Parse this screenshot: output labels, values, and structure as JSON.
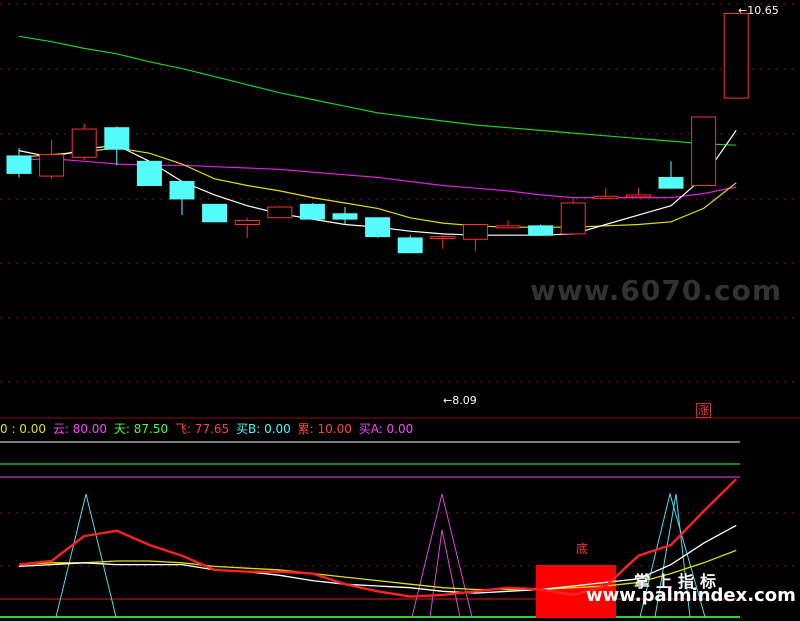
{
  "legend": [
    {
      "label": "0 : 0.00",
      "color": "#e0e000"
    },
    {
      "label": "云: 80.00",
      "color": "#ff40ff"
    },
    {
      "label": "天: 87.50",
      "color": "#40ff40"
    },
    {
      "label": "飞: 77.65",
      "color": "#ff4040"
    },
    {
      "label": "买B: 0.00",
      "color": "#40ffff"
    },
    {
      "label": "累: 10.00",
      "color": "#ff4040"
    },
    {
      "label": "买A: 0.00",
      "color": "#ff40ff"
    }
  ],
  "labels": {
    "high": "10.65",
    "low": "8.09",
    "zhang": "涨",
    "di": "底",
    "watermark": "www.6070.com",
    "brand": "掌上指标",
    "site": "www.palmindex.com"
  },
  "colors": {
    "up": "#ff3030",
    "down": "#54fcfc",
    "ma_long": "#20d020",
    "ma_mid": "#e020e0",
    "ma_short": "#e0e000",
    "ma_fast": "#ffffff",
    "grid": "#8a1010"
  },
  "chart_data": [
    {
      "type": "candlestick",
      "ylim": [
        7.7,
        10.75
      ],
      "candles": [
        {
          "o": 9.59,
          "c": 9.46,
          "h": 9.65,
          "l": 9.43
        },
        {
          "o": 9.44,
          "c": 9.6,
          "h": 9.71,
          "l": 9.42
        },
        {
          "o": 9.58,
          "c": 9.79,
          "h": 9.83,
          "l": 9.56
        },
        {
          "o": 9.8,
          "c": 9.64,
          "h": 9.81,
          "l": 9.52
        },
        {
          "o": 9.55,
          "c": 9.37,
          "h": 9.55,
          "l": 9.37
        },
        {
          "o": 9.4,
          "c": 9.27,
          "h": 9.4,
          "l": 9.15
        },
        {
          "o": 9.23,
          "c": 9.1,
          "h": 9.23,
          "l": 9.1
        },
        {
          "o": 9.08,
          "c": 9.11,
          "h": 9.13,
          "l": 8.98
        },
        {
          "o": 9.13,
          "c": 9.21,
          "h": 9.22,
          "l": 9.13
        },
        {
          "o": 9.23,
          "c": 9.12,
          "h": 9.24,
          "l": 9.12
        },
        {
          "o": 9.16,
          "c": 9.12,
          "h": 9.21,
          "l": 9.08
        },
        {
          "o": 9.13,
          "c": 8.99,
          "h": 9.13,
          "l": 8.98
        },
        {
          "o": 8.98,
          "c": 8.87,
          "h": 9.0,
          "l": 8.87
        },
        {
          "o": 8.98,
          "c": 8.99,
          "h": 9.0,
          "l": 8.9
        },
        {
          "o": 8.97,
          "c": 9.08,
          "h": 9.08,
          "l": 8.88
        },
        {
          "o": 9.06,
          "c": 9.07,
          "h": 9.11,
          "l": 9.05
        },
        {
          "o": 9.07,
          "c": 9.0,
          "h": 9.08,
          "l": 9.0
        },
        {
          "o": 9.01,
          "c": 9.24,
          "h": 9.28,
          "l": 9.0
        },
        {
          "o": 9.28,
          "c": 9.29,
          "h": 9.35,
          "l": 9.27
        },
        {
          "o": 9.29,
          "c": 9.3,
          "h": 9.35,
          "l": 9.29
        },
        {
          "o": 9.43,
          "c": 9.35,
          "h": 9.55,
          "l": 9.35
        },
        {
          "o": 9.37,
          "c": 9.88,
          "h": 9.88,
          "l": 9.37
        },
        {
          "o": 10.02,
          "c": 10.65,
          "h": 10.65,
          "l": 10.02
        }
      ],
      "ma_fast": [
        9.63,
        9.58,
        9.64,
        9.67,
        9.55,
        9.4,
        9.3,
        9.22,
        9.16,
        9.12,
        9.08,
        9.06,
        9.03,
        9.01,
        9.0,
        9.0,
        9.0,
        9.01,
        9.08,
        9.15,
        9.22,
        9.43,
        9.78
      ],
      "ma_short": [
        9.58,
        9.6,
        9.62,
        9.65,
        9.61,
        9.53,
        9.42,
        9.37,
        9.33,
        9.28,
        9.24,
        9.2,
        9.13,
        9.09,
        9.07,
        9.06,
        9.06,
        9.06,
        9.07,
        9.08,
        9.1,
        9.2,
        9.39
      ],
      "ma_mid": [
        9.56,
        9.57,
        9.55,
        9.53,
        9.52,
        9.52,
        9.51,
        9.5,
        9.49,
        9.47,
        9.45,
        9.43,
        9.4,
        9.37,
        9.35,
        9.33,
        9.3,
        9.28,
        9.28,
        9.28,
        9.28,
        9.31,
        9.36
      ],
      "ma_long": [
        10.48,
        10.44,
        10.39,
        10.35,
        10.29,
        10.24,
        10.18,
        10.12,
        10.06,
        10.01,
        9.96,
        9.91,
        9.88,
        9.85,
        9.82,
        9.8,
        9.78,
        9.76,
        9.74,
        9.72,
        9.7,
        9.68,
        9.67
      ]
    },
    {
      "type": "line",
      "ylim": [
        0,
        100
      ],
      "series": [
        {
          "values": [
            30,
            32,
            46,
            49,
            41,
            35,
            27,
            26,
            26,
            25,
            19,
            15,
            12,
            13,
            15,
            17,
            16,
            13,
            18,
            35,
            41,
            60,
            78
          ]
        },
        {
          "values": [
            29,
            30,
            31,
            30,
            30,
            30,
            27,
            26,
            24,
            21,
            19,
            18,
            17,
            15,
            14,
            15,
            16,
            18,
            20,
            22,
            30,
            42,
            52
          ]
        },
        {
          "values": [
            30,
            31,
            31,
            32,
            32,
            31,
            29,
            28,
            27,
            25,
            23,
            21,
            19,
            17,
            16,
            16,
            16,
            17,
            18,
            20,
            25,
            31,
            38
          ]
        }
      ]
    }
  ]
}
